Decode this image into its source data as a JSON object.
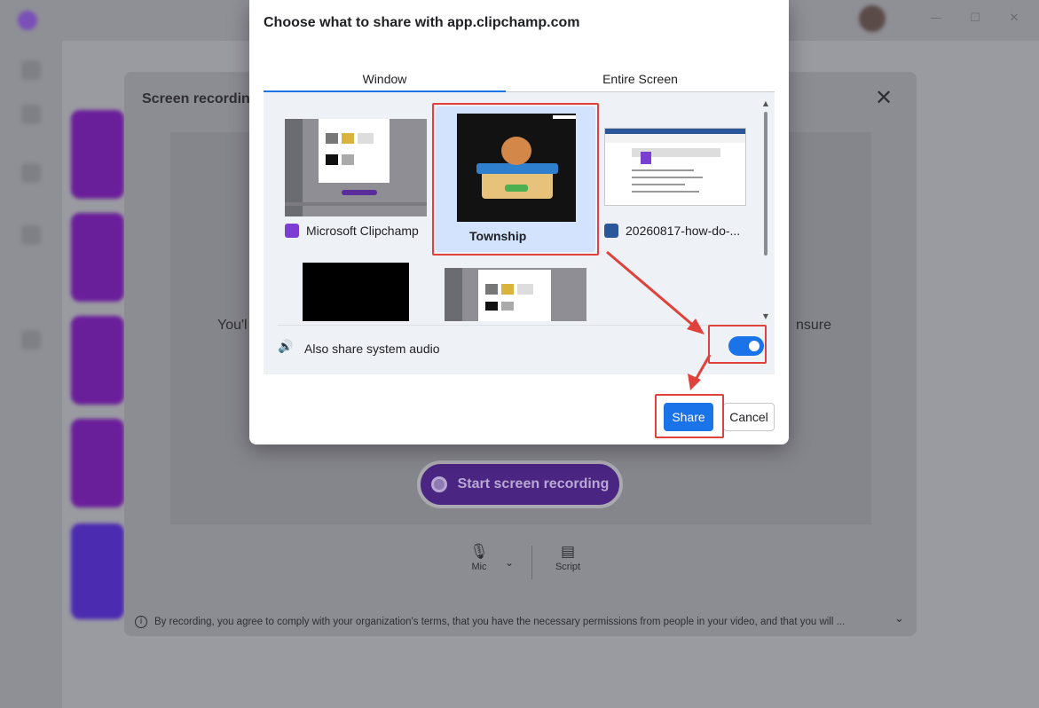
{
  "background_app": {
    "window_controls": [
      "—",
      "☐",
      "✕"
    ]
  },
  "recording_modal": {
    "title": "Screen recording",
    "close_glyph": "✕",
    "instruction_left": "You'l",
    "instruction_right": "nsure",
    "start_button_label": "Start screen recording",
    "tools": [
      {
        "label": "Mic",
        "icon": "microphone-icon"
      },
      {
        "label": "Script",
        "icon": "script-icon"
      }
    ],
    "footer_text": "By recording, you agree to comply with your organization's terms, that you have the necessary permissions from people in your video, and that you will ..."
  },
  "share_dialog": {
    "title": "Choose what to share with app.clipchamp.com",
    "tabs": [
      {
        "label": "Window",
        "active": true
      },
      {
        "label": "Entire Screen",
        "active": false
      }
    ],
    "windows": [
      {
        "label": "Microsoft Clipchamp",
        "icon": "clipchamp-icon",
        "selected": false
      },
      {
        "label": "Township",
        "icon": "",
        "selected": true
      },
      {
        "label": "20260817-how-do-...",
        "icon": "word-icon",
        "selected": false
      },
      {
        "label": "",
        "icon": "",
        "selected": false
      },
      {
        "label": "",
        "icon": "",
        "selected": false
      }
    ],
    "audio_label": "Also share system audio",
    "audio_enabled": true,
    "share_button": "Share",
    "cancel_button": "Cancel"
  },
  "colors": {
    "accent": "#1a73e8",
    "selected_tile": "#d3e3fd",
    "annotation": "#e0413b",
    "clipchamp_purple": "#6a1f9a"
  }
}
